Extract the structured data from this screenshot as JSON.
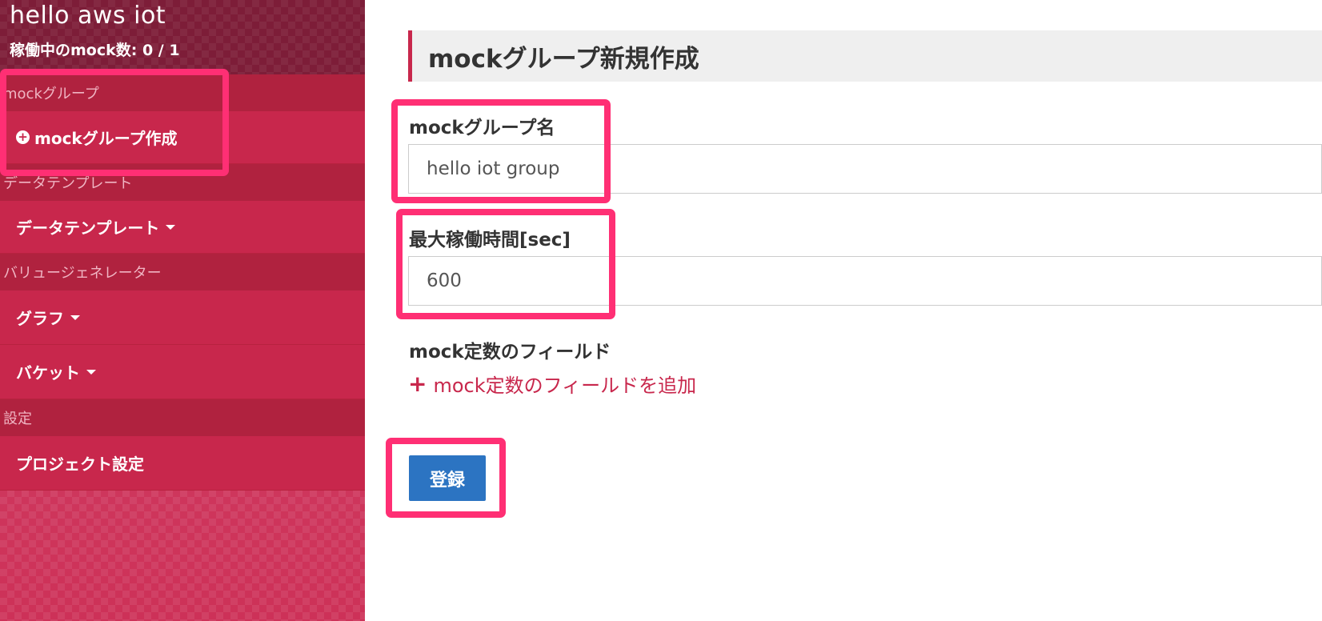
{
  "app": {
    "title": "hello aws iot",
    "running_count": "稼働中のmock数: 0 / 1"
  },
  "sidebar": {
    "sections": [
      {
        "label": "mockグループ",
        "items": [
          {
            "label": "mockグループ作成",
            "icon": "plus-circle-icon"
          }
        ]
      },
      {
        "label": "データテンプレート",
        "items": [
          {
            "label": "データテンプレート",
            "icon": "caret-down-icon"
          }
        ]
      },
      {
        "label": "バリュージェネレーター",
        "items": [
          {
            "label": "グラフ",
            "icon": "caret-down-icon"
          },
          {
            "label": "バケット",
            "icon": "caret-down-icon"
          }
        ]
      },
      {
        "label": "設定",
        "items": [
          {
            "label": "プロジェクト設定"
          }
        ]
      }
    ]
  },
  "main": {
    "heading": "mockグループ新規作成",
    "group_name": {
      "label": "mockグループ名",
      "value": "hello iot group"
    },
    "max_runtime": {
      "label": "最大稼働時間[sec]",
      "value": "600"
    },
    "const_fields": {
      "label": "mock定数のフィールド",
      "add_link": "mock定数のフィールドを追加"
    },
    "submit": "登録"
  },
  "colors": {
    "sidebar_bg": "#c8274c",
    "sidebar_section_bg": "#b0223f",
    "sidebar_header_bg": "#7d1d38",
    "accent": "#c8274c",
    "button": "#2c74c2",
    "highlight": "#ff2f74"
  }
}
